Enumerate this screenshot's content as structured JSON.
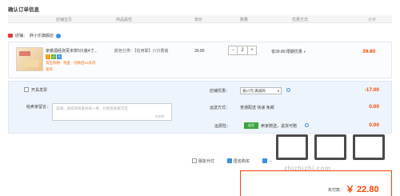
{
  "page": {
    "title": "确认订单信息"
  },
  "columns": [
    "店铺宝贝",
    "商品属性",
    "单价",
    "数量",
    "优惠方式",
    "小计"
  ],
  "store": {
    "label": "店铺：",
    "name": "胖小乐旗舰店"
  },
  "item": {
    "title": "家傲酒经烧芙米饼5只装4寸...",
    "badges": [
      "7",
      "◎",
      "卡"
    ],
    "meta1": "淘宝购物 · 现金 · 付款后10天内",
    "meta2": "发货",
    "attr": "颜色分类：【信用联】六只香装",
    "unit_price": "39.80",
    "qty": "2",
    "qty_minus": "−",
    "qty_plus": "+",
    "promo": "省39.80:限期优惠",
    "promo_caret": "▾",
    "subtotal": "39.80"
  },
  "options": {
    "invoice_label": "开具发票",
    "memo_label": "给卖家留言：",
    "memo_placeholder": "选填，请先和商家协商一致，付款后商家可见",
    "memo_count": "0/200",
    "shop_discount_label": "店铺优惠：",
    "shop_discount_select": "省17元:满减商",
    "shop_discount_caret": "▾",
    "shop_discount_amount": "-17.00",
    "shipping_label": "运送方式：",
    "shipping_value": "普通配送 快递 免邮",
    "shipping_amount": "0.00",
    "insurance_label": "运费险：",
    "insurance_tag": "退货",
    "insurance_value": "卖家赠送，退货可赔",
    "insurance_amount": "0.00"
  },
  "footer": {
    "opt1": "朋友代付",
    "opt2": "匿名购买",
    "opt3": "...",
    "pay_label": "实付款：",
    "pay_amount": "￥ 22.80",
    "watermark_url": "zhizhizhi.com"
  },
  "colors": {
    "accent": "#ff4400",
    "link_blue": "#3b8fe6",
    "green": "#3aa63f"
  }
}
